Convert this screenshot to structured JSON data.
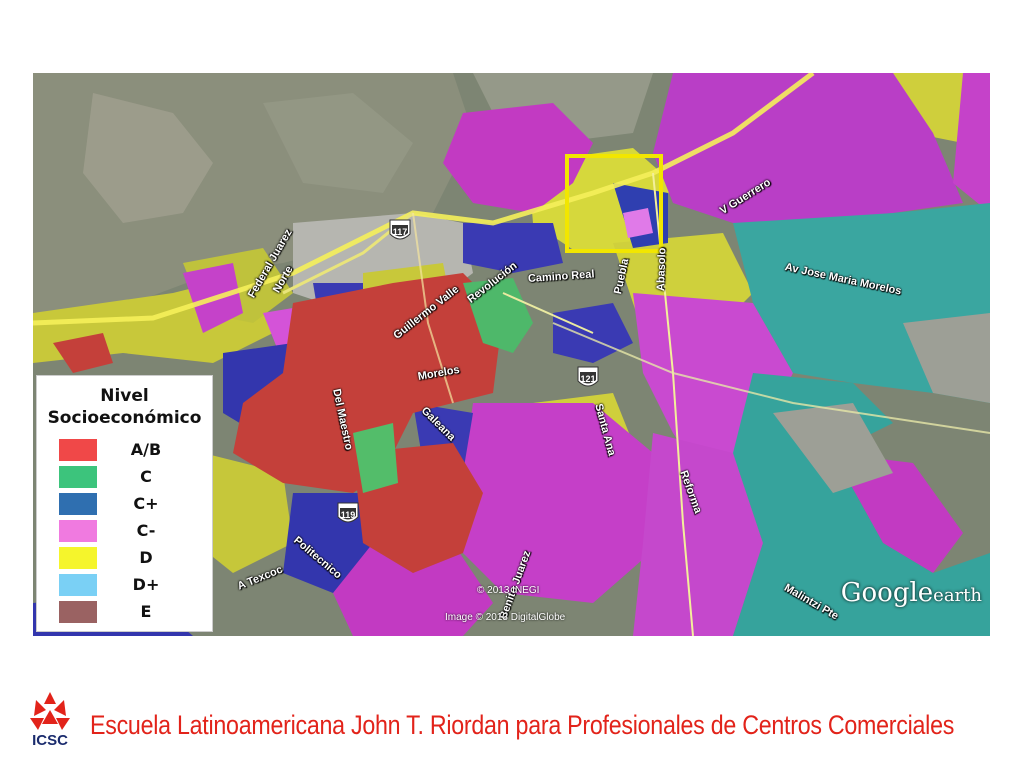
{
  "legend": {
    "title_line1": "Nivel",
    "title_line2": "Socioeconómico",
    "items": [
      {
        "label": "A/B",
        "color": "#f04848"
      },
      {
        "label": "C",
        "color": "#3cc47c"
      },
      {
        "label": "C+",
        "color": "#2f6fb0"
      },
      {
        "label": "C-",
        "color": "#f07ae0"
      },
      {
        "label": "D",
        "color": "#f5f52c"
      },
      {
        "label": "D+",
        "color": "#7ad0f5"
      },
      {
        "label": "E",
        "color": "#9a6262"
      }
    ]
  },
  "map": {
    "street_labels": {
      "guillermo_valle": "Guillermo Valle",
      "revolucion": "Revolución",
      "camino_real": "Camino Real",
      "puebla": "Puebla",
      "abasolo": "Abasolo",
      "v_guerrero": "V Guerrero",
      "jose_maria_morelos": "Av Jose Maria Morelos",
      "federal_juarez": "Federal Juarez",
      "norte": "Norte",
      "del_maestro": "Del Maestro",
      "morelos": "Morelos",
      "galeana": "Galeana",
      "reforma": "Reforma",
      "politecnico": "Politecnico",
      "a_texcoc": "A Texcoc",
      "malintzi": "Malintzi Pte",
      "benito_juarez": "Benito Juarez",
      "santa_ana": "Santa Ana"
    },
    "shields": {
      "s117": "117",
      "s119": "119",
      "s121": "121"
    },
    "credits": {
      "inegi": "© 2013 INEGI",
      "digitalglobe": "Image © 2013 DigitalGlobe",
      "brand": "Google",
      "brand_suffix": "earth"
    }
  },
  "footer": {
    "logo_text": "ICSC",
    "school_name": "Escuela Latinoamericana John T. Riordan para Profesionales de Centros Comerciales",
    "brand_color": "#e2231a"
  }
}
